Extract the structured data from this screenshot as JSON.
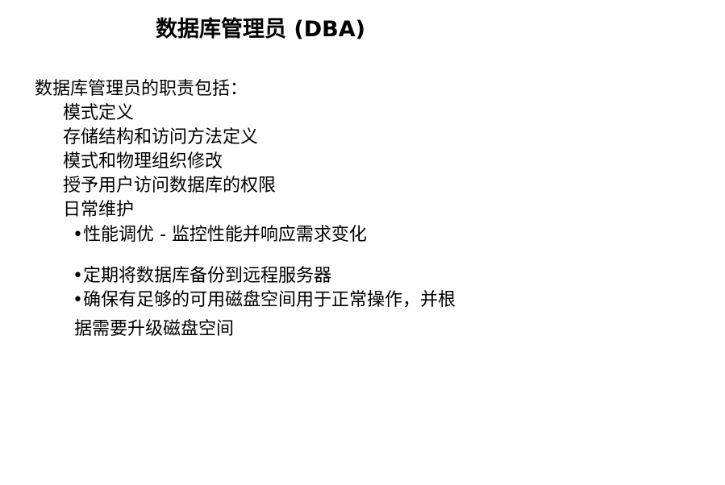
{
  "slide": {
    "title": "数据库管理员 (DBA)",
    "intro": "数据库管理员的职责包括：",
    "duties": [
      "模式定义",
      "存储结构和访问方法定义",
      "模式和物理组织修改",
      "授予用户访问数据库的权限",
      "日常维护"
    ],
    "maintenance": [
      "•性能调优 - 监控性能并响应需求变化",
      "•定期将数据库备份到远程服务器",
      "•确保有足够的可用磁盘空间用于正常操作，并根"
    ],
    "maintenance_continuation": "据需要升级磁盘空间"
  }
}
